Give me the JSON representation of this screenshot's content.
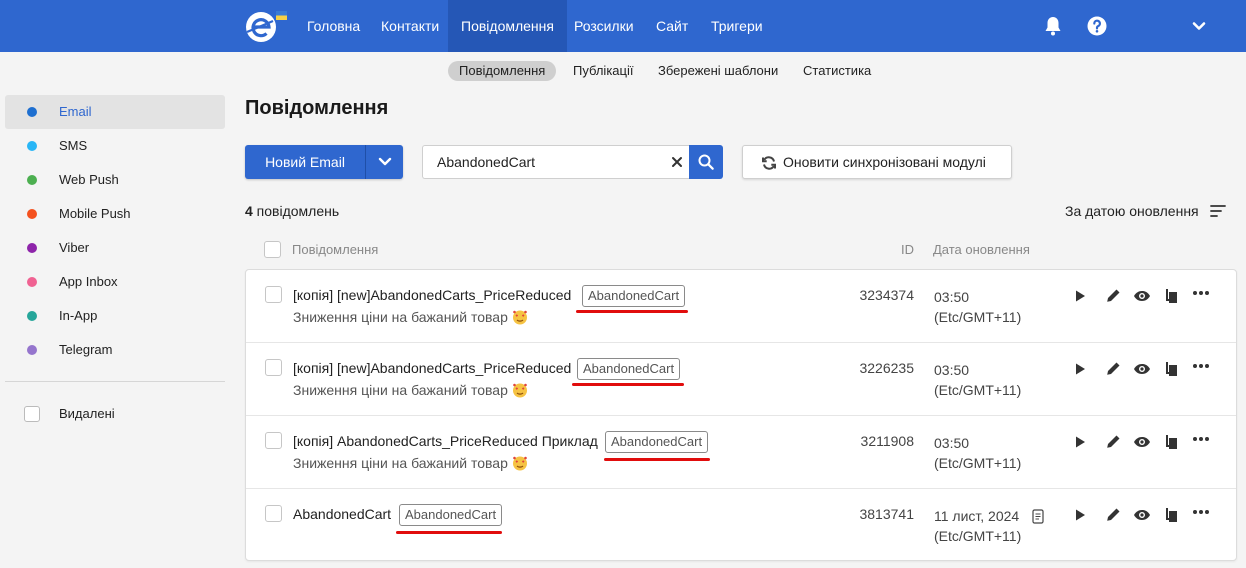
{
  "nav": {
    "items": [
      "Головна",
      "Контакти",
      "Повідомлення",
      "Розсилки",
      "Сайт",
      "Тригери"
    ],
    "active_index": 2
  },
  "subnav": {
    "items": [
      "Повідомлення",
      "Публікації",
      "Збережені шаблони",
      "Статистика"
    ],
    "active_index": 0
  },
  "sidebar": {
    "items": [
      {
        "label": "Email",
        "color": "#1e6fd0"
      },
      {
        "label": "SMS",
        "color": "#29b6f6"
      },
      {
        "label": "Web Push",
        "color": "#4caf50"
      },
      {
        "label": "Mobile Push",
        "color": "#f4511e"
      },
      {
        "label": "Viber",
        "color": "#8e24aa"
      },
      {
        "label": "App Inbox",
        "color": "#f06292"
      },
      {
        "label": "In-App",
        "color": "#26a69a"
      },
      {
        "label": "Telegram",
        "color": "#9575cd"
      }
    ],
    "active_index": 0,
    "deleted_label": "Видалені"
  },
  "page": {
    "title": "Повідомлення",
    "new_button": "Новий Email",
    "search_value": "AbandonedCart",
    "sync_button": "Оновити синхронізовані модулі",
    "count_number": "4",
    "count_text": " повідомлень",
    "sort_label": "За датою оновлення"
  },
  "table": {
    "headers": {
      "message": "Повідомлення",
      "id": "ID",
      "date": "Дата оновлення"
    },
    "rows": [
      {
        "title": "[копія]  [new]AbandonedCarts_PriceReduced",
        "tag": "AbandonedCart",
        "subtitle": "Зниження ціни на бажаний товар",
        "id": "3234374",
        "date1": "03:50",
        "date2": "(Etc/GMT+11)"
      },
      {
        "title": "[копія] [new]AbandonedCarts_PriceReduced",
        "tag": "AbandonedCart",
        "subtitle": "Зниження ціни на бажаний товар",
        "id": "3226235",
        "date1": "03:50",
        "date2": "(Etc/GMT+11)"
      },
      {
        "title": "[копія] AbandonedCarts_PriceReduced Приклад",
        "tag": "AbandonedCart",
        "subtitle": "Зниження ціни на бажаний товар",
        "id": "3211908",
        "date1": "03:50",
        "date2": "(Etc/GMT+11)"
      },
      {
        "title": "AbandonedCart",
        "tag": "AbandonedCart",
        "subtitle": "",
        "id": "3813741",
        "date1": "11 лист, 2024",
        "date2": "(Etc/GMT+11)"
      }
    ]
  },
  "colors": {
    "brand": "#2f67cf",
    "annotation": "#e10d0d"
  }
}
